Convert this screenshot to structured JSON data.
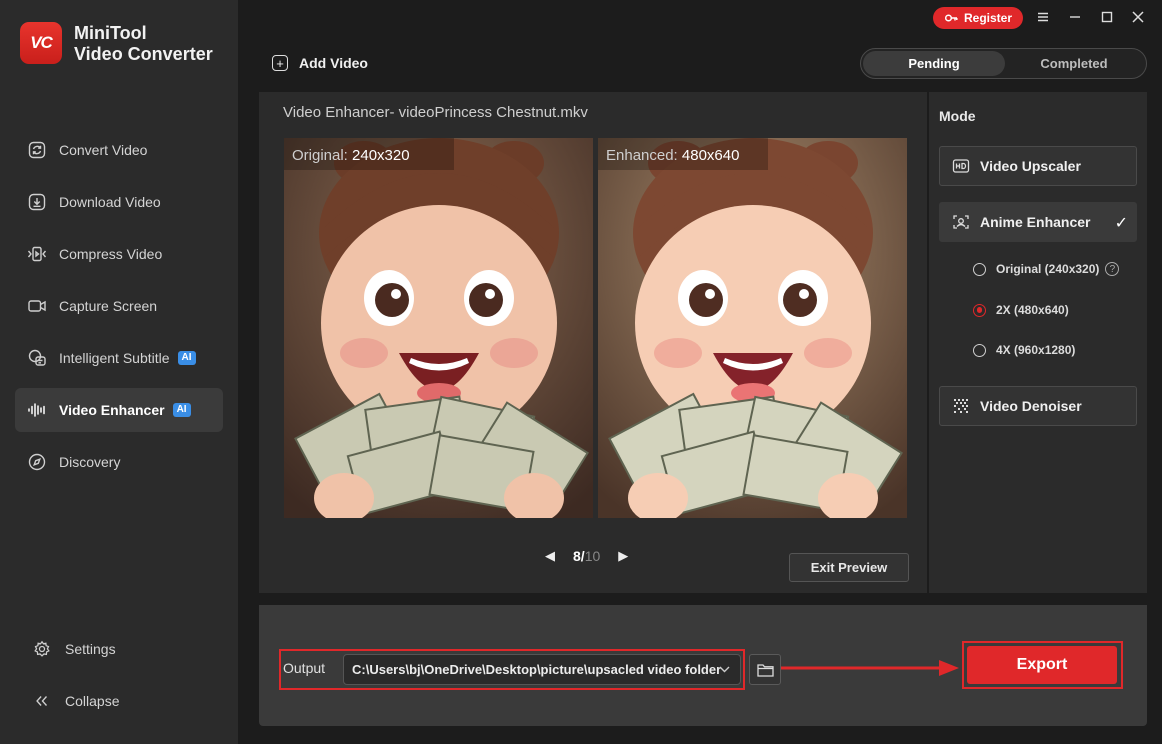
{
  "app": {
    "logo_text": "VC",
    "name_line1": "MiniTool",
    "name_line2": "Video Converter"
  },
  "titlebar": {
    "register_label": "Register"
  },
  "sidebar": {
    "items": [
      {
        "label": "Convert Video",
        "icon": "convert-icon",
        "badge": ""
      },
      {
        "label": "Download Video",
        "icon": "download-icon",
        "badge": ""
      },
      {
        "label": "Compress Video",
        "icon": "compress-icon",
        "badge": ""
      },
      {
        "label": "Capture Screen",
        "icon": "camera-icon",
        "badge": ""
      },
      {
        "label": "Intelligent Subtitle",
        "icon": "subtitle-icon",
        "badge": "AI"
      },
      {
        "label": "Video Enhancer",
        "icon": "waveform-icon",
        "badge": "AI",
        "active": true
      },
      {
        "label": "Discovery",
        "icon": "compass-icon",
        "badge": ""
      }
    ],
    "settings_label": "Settings",
    "collapse_label": "Collapse"
  },
  "toolbar": {
    "add_video_label": "Add Video",
    "tabs": {
      "pending": "Pending",
      "completed": "Completed",
      "active": "pending"
    }
  },
  "preview": {
    "title": "Video Enhancer- videoPrincess Chestnut.mkv",
    "original_label": "Original:",
    "original_res": "240x320",
    "enhanced_label": "Enhanced:",
    "enhanced_res": "480x640",
    "current_page": "8",
    "page_sep": "/",
    "total_pages": "10",
    "exit_label": "Exit Preview"
  },
  "mode": {
    "title": "Mode",
    "upscaler_label": "Video Upscaler",
    "anime_label": "Anime Enhancer",
    "anime_selected": true,
    "options": [
      {
        "label": "Original (240x320)",
        "selected": false,
        "help": "?"
      },
      {
        "label": "2X (480x640)",
        "selected": true
      },
      {
        "label": "4X (960x1280)",
        "selected": false
      }
    ],
    "denoiser_label": "Video Denoiser"
  },
  "output": {
    "label": "Output",
    "path": "C:\\Users\\bj\\OneDrive\\Desktop\\picture\\upsacled video folder",
    "export_label": "Export"
  },
  "colors": {
    "accent": "#e0282a",
    "ai_badge": "#3a8ee6",
    "sidebar_bg": "#2b2b2b",
    "main_bg": "#1c1c1c"
  }
}
